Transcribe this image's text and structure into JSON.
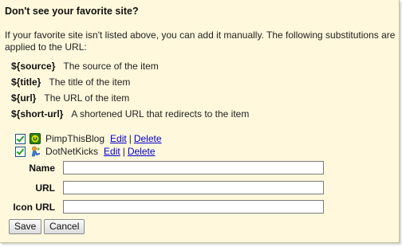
{
  "heading": "Don't see your favorite site?",
  "description": "If your favorite site isn't listed above, you can add it manually. The following substitutions are applied to the URL:",
  "substitutions": [
    {
      "key": "${source}",
      "desc": "The source of the item"
    },
    {
      "key": "${title}",
      "desc": "The title of the item"
    },
    {
      "key": "${url}",
      "desc": "The URL of the item"
    },
    {
      "key": "${short-url}",
      "desc": "A shortened URL that redirects to the item"
    }
  ],
  "sites": [
    {
      "name": "PimpThisBlog",
      "checked": true,
      "icon": "pimpthisblog-icon",
      "edit_label": "Edit",
      "delete_label": "Delete"
    },
    {
      "name": "DotNetKicks",
      "checked": true,
      "icon": "dotnetkicks-icon",
      "edit_label": "Edit",
      "delete_label": "Delete"
    }
  ],
  "separator": "|",
  "form": {
    "name_label": "Name",
    "url_label": "URL",
    "icon_url_label": "Icon URL",
    "name_value": "",
    "url_value": "",
    "icon_url_value": ""
  },
  "buttons": {
    "save_label": "Save",
    "cancel_label": "Cancel"
  },
  "colors": {
    "panel_background": "#fff8dc",
    "link": "#0000cc",
    "checkmark": "#21a121"
  }
}
